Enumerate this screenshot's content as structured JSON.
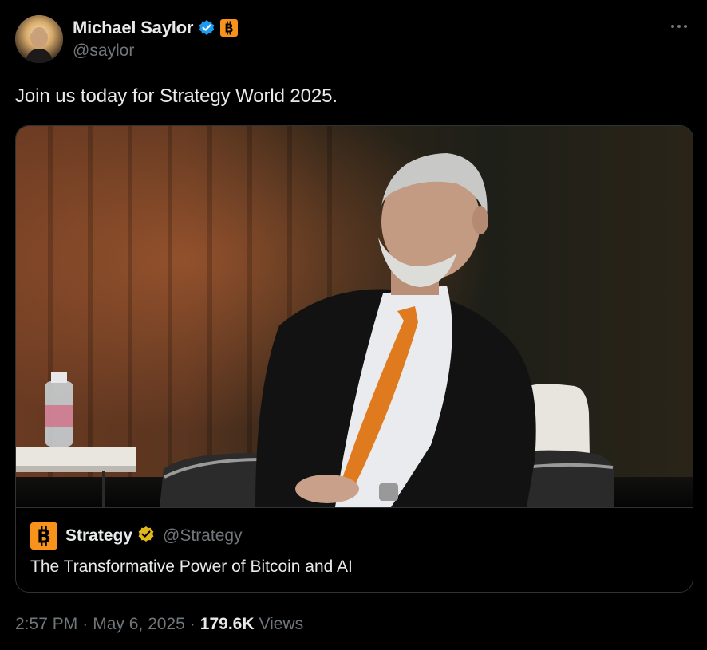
{
  "author": {
    "display_name": "Michael Saylor",
    "handle": "@saylor",
    "avatar_icon": "profile-avatar",
    "verified_icon": "blue-verified-badge-icon",
    "affiliate_icon": "bitcoin-badge-icon"
  },
  "more_icon": "more-horizontal-icon",
  "tweet": {
    "text": "Join us today for Strategy World 2025."
  },
  "quote": {
    "author_name": "Strategy",
    "author_handle": "@Strategy",
    "author_icon": "bitcoin-logo-icon",
    "verified_icon": "gold-verified-badge-icon",
    "text": "The Transformative Power of Bitcoin and AI"
  },
  "meta": {
    "time": "2:57 PM",
    "separator": "·",
    "date": "May 6, 2025",
    "views_count": "179.6K",
    "views_label": "Views"
  },
  "colors": {
    "background": "#000000",
    "primary_text": "#e7e9ea",
    "secondary_text": "#71767b",
    "border": "#2f3336",
    "verified_blue": "#1d9bf0",
    "verified_gold": "#e2b719",
    "bitcoin_orange": "#f7931a",
    "tie_orange": "#e07a1e"
  }
}
